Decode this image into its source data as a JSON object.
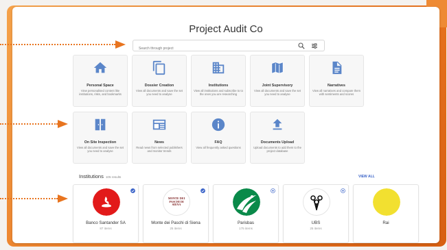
{
  "app": {
    "title": "Project Audit Co"
  },
  "search": {
    "placeholder": "Search through project"
  },
  "tiles": [
    {
      "title": "Personal Space",
      "desc": "View personalised content like institutions, risks, and bookmarks",
      "icon": "home-icon"
    },
    {
      "title": "Dossier Creation",
      "desc": "View all documents and save the set you need to analyse",
      "icon": "copy-icon"
    },
    {
      "title": "Institutions",
      "desc": "View all institutions and subscribe to to the ones you are researching",
      "icon": "building-icon"
    },
    {
      "title": "Joint Supervisory",
      "desc": "View all documents and save the set you need to analyse",
      "icon": "map-icon"
    },
    {
      "title": "Narratives",
      "desc": "View all narratives and compare them with sentiments and scores",
      "icon": "document-icon"
    },
    {
      "title": "On Site Inspection",
      "desc": "View all documents and save the set you need to analyse",
      "icon": "door-icon"
    },
    {
      "title": "News",
      "desc": "Read news from selected publishers and monitor trends",
      "icon": "newspaper-icon"
    },
    {
      "title": "FAQ",
      "desc": "View all frequently asked questions",
      "icon": "info-icon"
    },
    {
      "title": "Documents Upload",
      "desc": "Upload documents to add them to the project database",
      "icon": "upload-icon"
    }
  ],
  "institutions": {
    "heading": "Institutions",
    "count": "105 results",
    "view_all": "VIEW ALL",
    "items": [
      {
        "name": "Banco Santander SA",
        "items": "87 items"
      },
      {
        "name": "Monte dei Paschi di Siena",
        "items": "25 items",
        "logo_text": "MONTE DEI PASCHI DI SIENA"
      },
      {
        "name": "Parisbas",
        "items": "175 items"
      },
      {
        "name": "UBS",
        "items": "25 items"
      },
      {
        "name": "Rai",
        "items": ""
      }
    ]
  },
  "colors": {
    "accent": "#3b64c8",
    "icon_blue": "#5b86c9",
    "orange": "#e8741f"
  }
}
